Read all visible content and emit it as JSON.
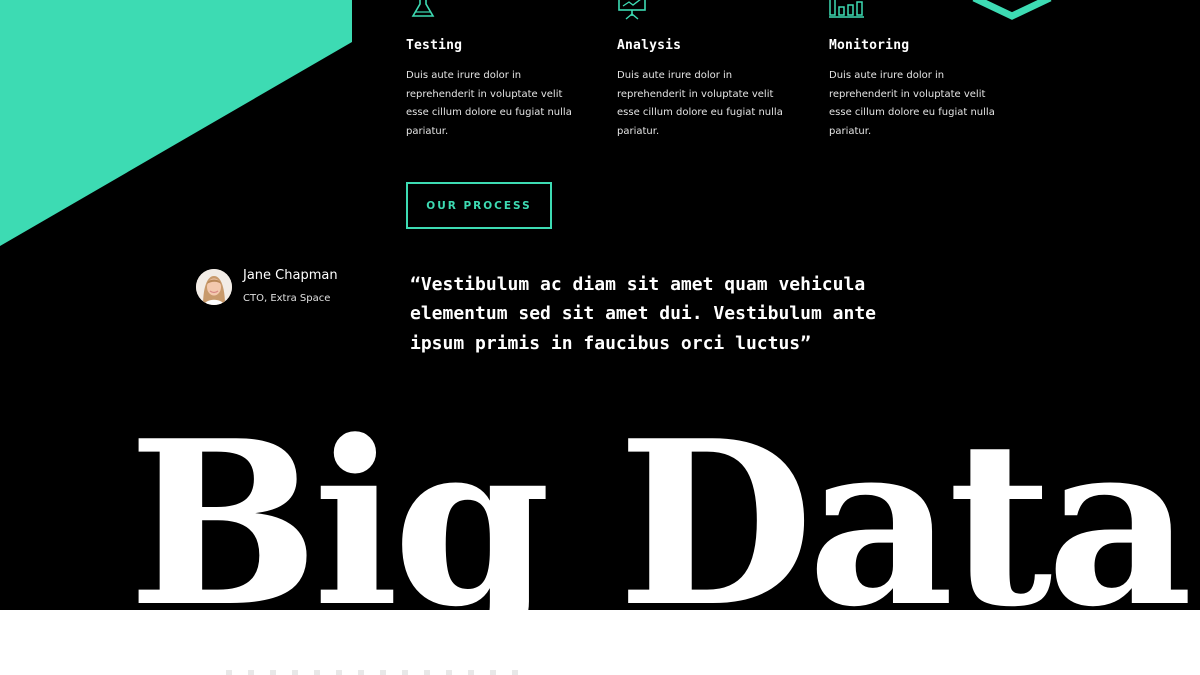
{
  "features": [
    {
      "icon": "flask-icon",
      "title": "Testing",
      "text": "Duis aute irure dolor in reprehenderit in voluptate velit esse cillum dolore eu fugiat nulla pariatur."
    },
    {
      "icon": "presentation-board-icon",
      "title": "Analysis",
      "text": "Duis aute irure dolor in reprehenderit in voluptate velit esse cillum dolore eu fugiat nulla pariatur."
    },
    {
      "icon": "bar-chart-icon",
      "title": "Monitoring",
      "text": "Duis aute irure dolor in reprehenderit in voluptate velit esse cillum dolore eu fugiat nulla pariatur."
    }
  ],
  "cta": {
    "label": "OUR PROCESS"
  },
  "testimonial": {
    "name": "Jane Chapman",
    "role": "CTO, Extra Space",
    "quote": "“Vestibulum ac diam sit amet quam vehicula elementum sed sit amet dui. Vestibulum ante ipsum primis in faucibus orci luctus”"
  },
  "hero": {
    "title": "Big Data"
  },
  "colors": {
    "accent": "#3ddbb3",
    "background": "#000000",
    "text": "#ffffff"
  }
}
